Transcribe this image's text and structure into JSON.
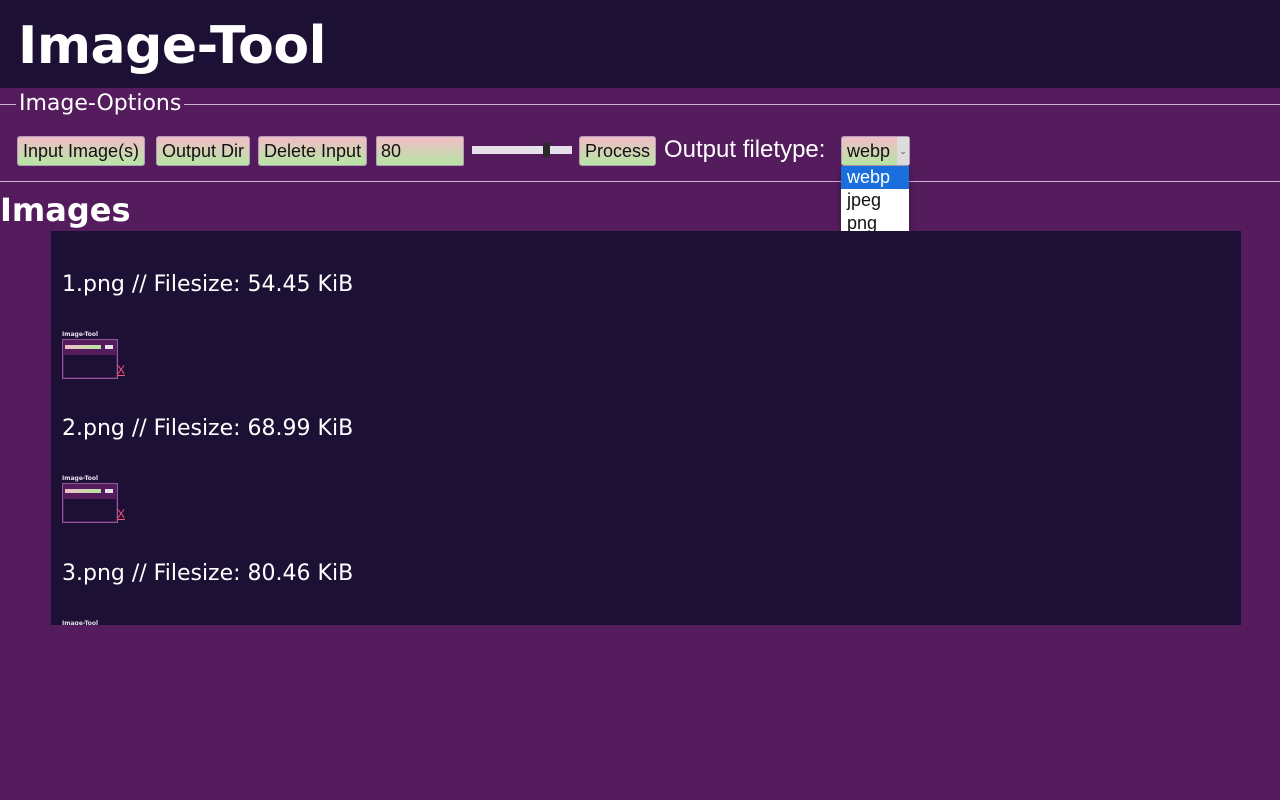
{
  "app": {
    "title": "Image-Tool"
  },
  "options": {
    "legend": "Image-Options",
    "input_button": "Input Image(s)",
    "output_dir_button": "Output Dir",
    "delete_input_button": "Delete Input",
    "quality_value": "80",
    "slider_level": 0.8,
    "process_button": "Process",
    "filetype_label": "Output filetype:",
    "filetype_selected": "webp",
    "filetype_options": [
      "webp",
      "jpeg",
      "png"
    ]
  },
  "images": {
    "heading": "Images",
    "thumb_caption": "Image-Tool",
    "remove_label": "X",
    "items": [
      {
        "title": "1.png // Filesize: 54.45 KiB"
      },
      {
        "title": "2.png // Filesize: 68.99 KiB"
      },
      {
        "title": "3.png // Filesize: 80.46 KiB"
      }
    ]
  },
  "colors": {
    "background": "#541c5c",
    "header": "#1c1034",
    "button_gradient_top": "#f1bcc7",
    "button_gradient_bottom": "#b7e6a4",
    "dropdown_highlight": "#1a6fdc",
    "remove_link": "#ff4f7a"
  }
}
